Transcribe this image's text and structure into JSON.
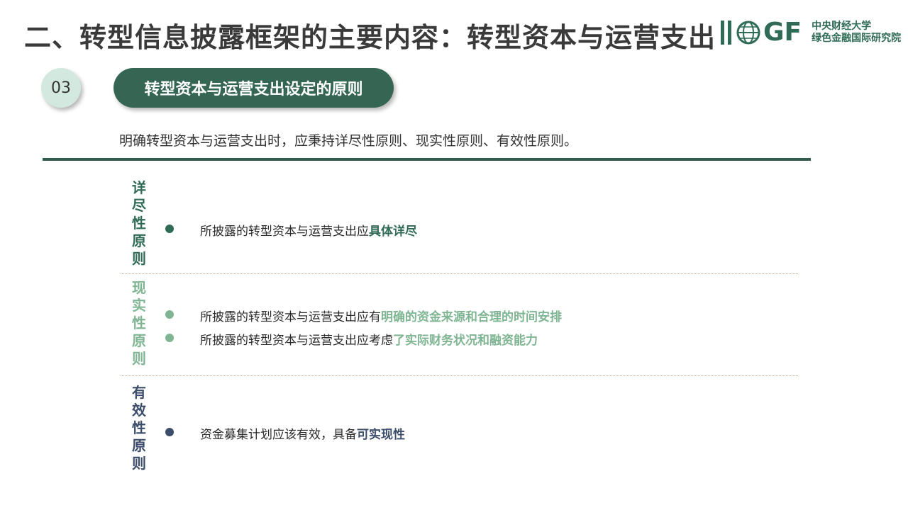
{
  "header": {
    "title": "二、转型信息披露框架的主要内容：转型资本与运营支出",
    "logo_letters": "GF",
    "logo_line1": "中央财经大学",
    "logo_line2": "绿色金融国际研究院"
  },
  "section": {
    "number": "03",
    "heading": "转型资本与运营支出设定的原则"
  },
  "intro": "明确转型资本与运营支出时，应秉持详尽性原则、现实性原则、有效性原则。",
  "colors": {
    "dark_green": "#2f6b55",
    "light_green": "#7fb592",
    "navy": "#3b4d6b"
  },
  "principles": [
    {
      "chars": [
        "详",
        "尽",
        "性",
        "原",
        "则"
      ],
      "items": [
        {
          "prefix": "所披露的转型资本与运营支出应",
          "emphasis": "具体详尽"
        }
      ]
    },
    {
      "chars": [
        "现",
        "实",
        "性",
        "原",
        "则"
      ],
      "items": [
        {
          "prefix": "所披露的转型资本与运营支出应有",
          "emphasis": "明确的资金来源和合理的时间安排"
        },
        {
          "prefix": "所披露的转型资本与运营支出应考虑",
          "emphasis": "了实际财务状况和融资能力"
        }
      ]
    },
    {
      "chars": [
        "有",
        "效",
        "性",
        "原",
        "则"
      ],
      "items": [
        {
          "prefix": "资金募集计划应该有效，具备",
          "emphasis": "可实现性"
        }
      ]
    }
  ]
}
